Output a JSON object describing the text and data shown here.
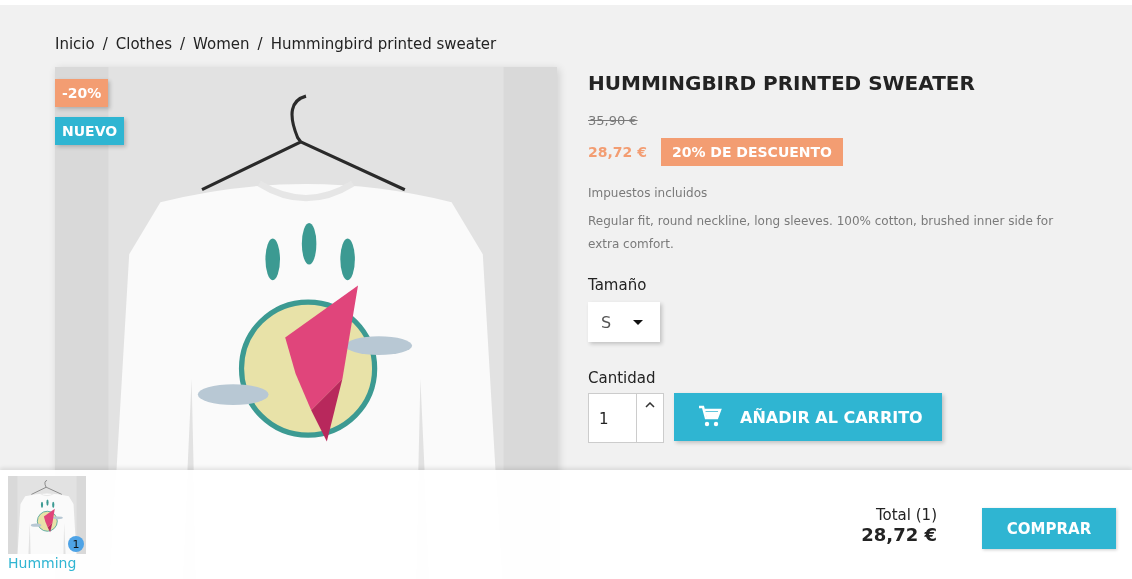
{
  "breadcrumb": {
    "separator": "/",
    "items": [
      {
        "label": "Inicio"
      },
      {
        "label": "Clothes"
      },
      {
        "label": "Women"
      },
      {
        "label": "Hummingbird printed sweater"
      }
    ]
  },
  "product_image": {
    "kind": "picture",
    "flags": [
      {
        "label": "-20%",
        "kind": "discount"
      },
      {
        "label": "NUEVO",
        "kind": "new"
      }
    ]
  },
  "product": {
    "title": "HUMMINGBIRD PRINTED SWEATER",
    "regular_price": "35,90 €",
    "price": "28,72 €",
    "discount_badge": "20% DE DESCUENTO",
    "tax_note": "Impuestos incluidos",
    "description": "Regular fit, round neckline, long sleeves. 100% cotton, brushed inner side for extra comfort."
  },
  "variant": {
    "label": "Tamaño",
    "value": "S"
  },
  "quantity": {
    "label": "Cantidad",
    "value": "1"
  },
  "add_to_cart": {
    "label": "AÑADIR AL CARRITO"
  },
  "cart_bar": {
    "items": [
      {
        "name": "Humming",
        "count": "1",
        "kind": "picture"
      }
    ],
    "total_label": "Total (1)",
    "total": "28,72 €",
    "checkout": "COMPRAR"
  }
}
